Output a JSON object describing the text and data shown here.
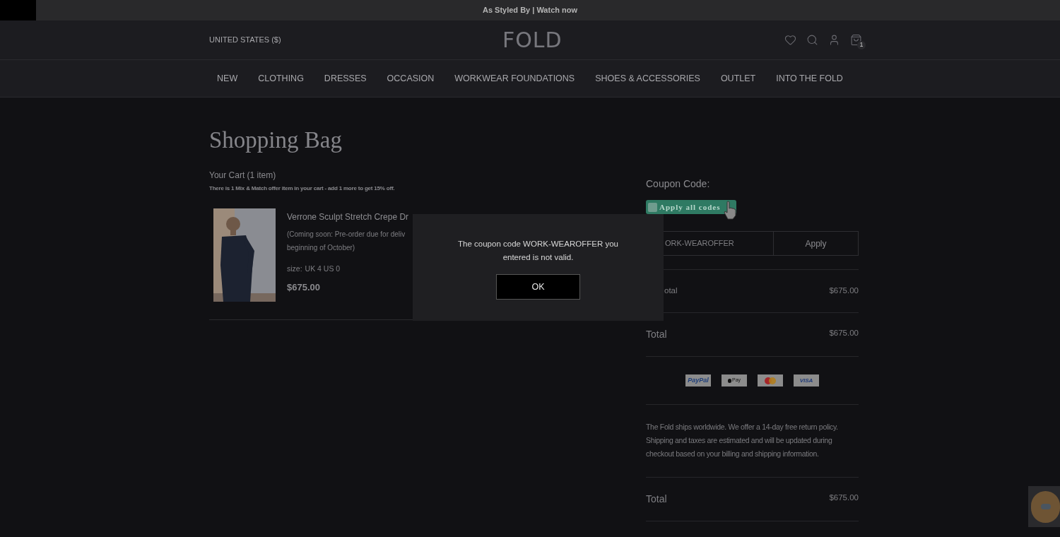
{
  "announcement": "As Styled By | Watch now",
  "header": {
    "region": "UNITED STATES ($)",
    "logo": "FOLD",
    "cart_count": "1"
  },
  "nav": [
    "NEW",
    "CLOTHING",
    "DRESSES",
    "OCCASION",
    "WORKWEAR FOUNDATIONS",
    "SHOES & ACCESSORIES",
    "OUTLET",
    "INTO THE FOLD"
  ],
  "page_title": "Shopping Bag",
  "cart": {
    "summary": "Your Cart (1 item)",
    "offer_note": "There is 1 Mix & Match offer item in your cart - add 1 more to get 15% off.",
    "item": {
      "name": "Verrone Sculpt Stretch Crepe Dr",
      "note_lines": [
        "(Coming soon: Pre-order due for deliv",
        "beginning of October)"
      ],
      "size_label": "size:",
      "size": "UK 4 US 0",
      "price": "$675.00"
    }
  },
  "coupon": {
    "heading": "Coupon Code:",
    "apply_all": "Apply all codes",
    "value": "ORK-WEAROFFER",
    "apply": "Apply"
  },
  "subtotal": {
    "label": "otal",
    "value": "$675.00"
  },
  "total": {
    "label": "Total",
    "value": "$675.00"
  },
  "payments": [
    {
      "kind": "paypal",
      "label": "PayPal"
    },
    {
      "kind": "applepay",
      "label": "Pay"
    },
    {
      "kind": "mastercard"
    },
    {
      "kind": "visa",
      "label": "VISA"
    }
  ],
  "shipping_note": "The Fold ships worldwide. We offer a 14-day free return policy. Shipping and taxes are estimated and will be updated during checkout based on your billing and shipping information.",
  "grand_total": {
    "label": "Total",
    "value": "$675.00"
  },
  "dialog": {
    "message": "The coupon code WORK-WEAROFFER you entered is not valid.",
    "ok": "OK"
  }
}
